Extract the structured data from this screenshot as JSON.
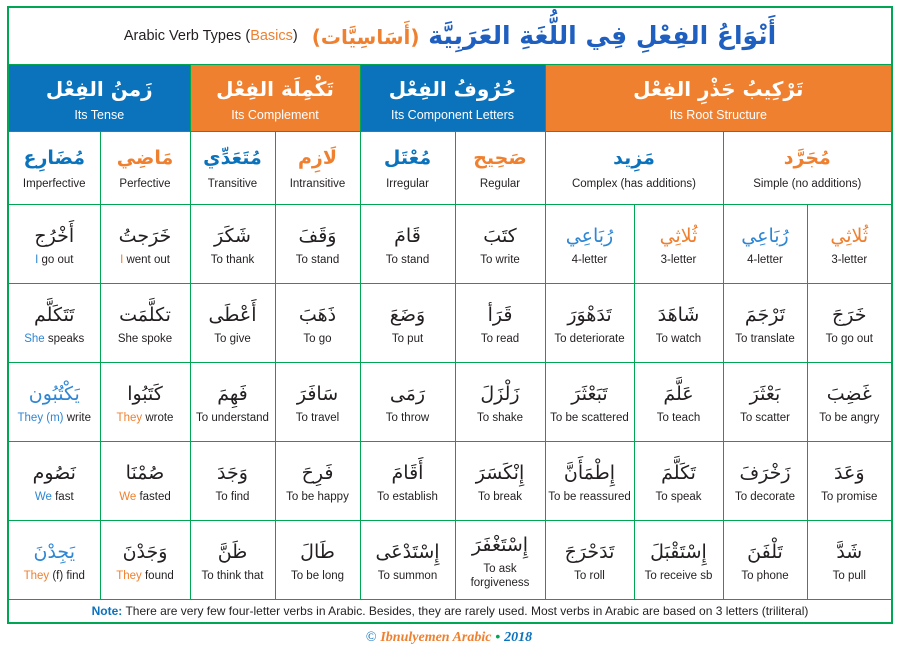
{
  "title": {
    "arabic_main": "أَنْوَاعُ الفِعْلِ فِي اللُّغَةِ العَرَبِيَّة",
    "arabic_paren": "(أَسَاسِيَّات)",
    "english_main": "Arabic Verb Types",
    "english_paren_open": "(",
    "english_basics": "Basics",
    "english_paren_close": ")"
  },
  "groups": [
    {
      "arabic": "زَمنُ الفِعْل",
      "english": "Its Tense",
      "color": "#0B72BC",
      "style": "blue",
      "span": 2
    },
    {
      "arabic": "تَكْمِلَة الفِعْل",
      "english": "Its Complement",
      "color": "#EF8030",
      "style": "orange",
      "span": 2
    },
    {
      "arabic": "حُرُوفُ الفِعْل",
      "english": "Its Component Letters",
      "color": "#0B72BC",
      "style": "blue",
      "span": 2
    },
    {
      "arabic": "تَرْكِيبُ جَذْرِ الفِعْل",
      "english": "Its Root Structure",
      "color": "#EF8030",
      "style": "orange",
      "span": 4
    }
  ],
  "subheaders": [
    {
      "arabic": "مُضَارِع",
      "english": "Imperfective",
      "color": "blue"
    },
    {
      "arabic": "مَاضِي",
      "english": "Perfective",
      "color": "orange"
    },
    {
      "arabic": "مُتَعَدِّي",
      "english": "Transitive",
      "color": "blue"
    },
    {
      "arabic": "لَازِم",
      "english": "Intransitive",
      "color": "orange"
    },
    {
      "arabic": "مُعْتَل",
      "english": "Irregular",
      "color": "blue"
    },
    {
      "arabic": "صَحِيح",
      "english": "Regular",
      "color": "orange"
    },
    {
      "arabic": "مَزِيد",
      "english": "Complex (has additions)",
      "color": "blue"
    },
    {
      "arabic": "مُجَرَّد",
      "english": "Simple (no additions)",
      "color": "orange"
    }
  ],
  "rows": [
    {
      "cells": [
        {
          "arabic": "أَخْرُج",
          "arabic_color": "plain",
          "english": "I go out",
          "english_highlight": "I",
          "highlight_color": "blue"
        },
        {
          "arabic": "خَرَجتُ",
          "arabic_color": "plain",
          "english": "I went out",
          "english_highlight": "I",
          "highlight_color": "orange"
        },
        {
          "arabic": "شَكَرَ",
          "arabic_color": "plain",
          "english": "To thank",
          "english_highlight": "",
          "highlight_color": ""
        },
        {
          "arabic": "وَقَفَ",
          "arabic_color": "plain",
          "english": "To stand",
          "english_highlight": "",
          "highlight_color": ""
        },
        {
          "arabic": "قَامَ",
          "arabic_color": "plain",
          "english": "To stand",
          "english_highlight": "",
          "highlight_color": ""
        },
        {
          "arabic": "كتَبَ",
          "arabic_color": "plain",
          "english": "To write",
          "english_highlight": "",
          "highlight_color": ""
        },
        {
          "arabic": "رُبَاعِي",
          "arabic_color": "blue",
          "english": "4-letter",
          "english_highlight": "",
          "highlight_color": ""
        },
        {
          "arabic": "ثُلاثِي",
          "arabic_color": "orange",
          "english": "3-letter",
          "english_highlight": "",
          "highlight_color": ""
        },
        {
          "arabic": "رُبَاعِي",
          "arabic_color": "blue",
          "english": "4-letter",
          "english_highlight": "",
          "highlight_color": ""
        },
        {
          "arabic": "ثُلاثِي",
          "arabic_color": "orange",
          "english": "3-letter",
          "english_highlight": "",
          "highlight_color": ""
        }
      ]
    },
    {
      "cells": [
        {
          "arabic": "تَتَكَلَّم",
          "arabic_color": "plain",
          "english": "She speaks",
          "english_highlight": "She",
          "highlight_color": "blue"
        },
        {
          "arabic": "تكلَّمَت",
          "arabic_color": "plain",
          "english": "She spoke",
          "english_highlight": "",
          "highlight_color": ""
        },
        {
          "arabic": "أَعْطَى",
          "arabic_color": "plain",
          "english": "To give",
          "english_highlight": "",
          "highlight_color": ""
        },
        {
          "arabic": "ذَهَبَ",
          "arabic_color": "plain",
          "english": "To go",
          "english_highlight": "",
          "highlight_color": ""
        },
        {
          "arabic": "وَضَعَ",
          "arabic_color": "plain",
          "english": "To put",
          "english_highlight": "",
          "highlight_color": ""
        },
        {
          "arabic": "قَرَأ",
          "arabic_color": "plain",
          "english": "To read",
          "english_highlight": "",
          "highlight_color": ""
        },
        {
          "arabic": "تَدَهْوَرَ",
          "arabic_color": "plain",
          "english": "To deteriorate",
          "english_highlight": "",
          "highlight_color": ""
        },
        {
          "arabic": "شَاهَدَ",
          "arabic_color": "plain",
          "english": "To watch",
          "english_highlight": "",
          "highlight_color": ""
        },
        {
          "arabic": "تَرْجَمَ",
          "arabic_color": "plain",
          "english": "To translate",
          "english_highlight": "",
          "highlight_color": ""
        },
        {
          "arabic": "خَرَجَ",
          "arabic_color": "plain",
          "english": "To go out",
          "english_highlight": "",
          "highlight_color": ""
        }
      ]
    },
    {
      "cells": [
        {
          "arabic": "يَكْتُبُون",
          "arabic_color": "blue",
          "english": "They (m) write",
          "english_highlight": "They (m)",
          "highlight_color": "blue"
        },
        {
          "arabic": "كَتَبُوا",
          "arabic_color": "plain",
          "english": "They wrote",
          "english_highlight": "They",
          "highlight_color": "orange"
        },
        {
          "arabic": "فَهِمَ",
          "arabic_color": "plain",
          "english": "To understand",
          "english_highlight": "",
          "highlight_color": ""
        },
        {
          "arabic": "سَافَرَ",
          "arabic_color": "plain",
          "english": "To travel",
          "english_highlight": "",
          "highlight_color": ""
        },
        {
          "arabic": "رَمَى",
          "arabic_color": "plain",
          "english": "To throw",
          "english_highlight": "",
          "highlight_color": ""
        },
        {
          "arabic": "زَلْزَلَ",
          "arabic_color": "plain",
          "english": "To shake",
          "english_highlight": "",
          "highlight_color": ""
        },
        {
          "arabic": "تَبَعْثَرَ",
          "arabic_color": "plain",
          "english": "To be scattered",
          "english_highlight": "",
          "highlight_color": ""
        },
        {
          "arabic": "عَلَّمَ",
          "arabic_color": "plain",
          "english": "To teach",
          "english_highlight": "",
          "highlight_color": ""
        },
        {
          "arabic": "بَعْثَرَ",
          "arabic_color": "plain",
          "english": "To scatter",
          "english_highlight": "",
          "highlight_color": ""
        },
        {
          "arabic": "غَضِبَ",
          "arabic_color": "plain",
          "english": "To be angry",
          "english_highlight": "",
          "highlight_color": ""
        }
      ]
    },
    {
      "cells": [
        {
          "arabic": "نَصُوم",
          "arabic_color": "plain",
          "english": "We fast",
          "english_highlight": "We",
          "highlight_color": "blue"
        },
        {
          "arabic": "صُمْنَا",
          "arabic_color": "plain",
          "english": "We fasted",
          "english_highlight": "We",
          "highlight_color": "orange"
        },
        {
          "arabic": "وَجَدَ",
          "arabic_color": "plain",
          "english": "To find",
          "english_highlight": "",
          "highlight_color": ""
        },
        {
          "arabic": "فَرِحَ",
          "arabic_color": "plain",
          "english": "To be happy",
          "english_highlight": "",
          "highlight_color": ""
        },
        {
          "arabic": "أَقَامَ",
          "arabic_color": "plain",
          "english": "To establish",
          "english_highlight": "",
          "highlight_color": ""
        },
        {
          "arabic": "إِنْكَسَرَ",
          "arabic_color": "plain",
          "english": "To break",
          "english_highlight": "",
          "highlight_color": ""
        },
        {
          "arabic": "إِطْمَأَنَّ",
          "arabic_color": "plain",
          "english": "To be reassured",
          "english_highlight": "",
          "highlight_color": ""
        },
        {
          "arabic": "تَكَلَّمَ",
          "arabic_color": "plain",
          "english": "To speak",
          "english_highlight": "",
          "highlight_color": ""
        },
        {
          "arabic": "زَخْرَفَ",
          "arabic_color": "plain",
          "english": "To decorate",
          "english_highlight": "",
          "highlight_color": ""
        },
        {
          "arabic": "وَعَدَ",
          "arabic_color": "plain",
          "english": "To promise",
          "english_highlight": "",
          "highlight_color": ""
        }
      ]
    },
    {
      "cells": [
        {
          "arabic": "يَجِدْنَ",
          "arabic_color": "blue",
          "english": "They (f) find",
          "english_highlight": "They",
          "highlight_color": "orange"
        },
        {
          "arabic": "وَجَدْنَ",
          "arabic_color": "plain",
          "english": "They found",
          "english_highlight": "They",
          "highlight_color": "orange"
        },
        {
          "arabic": "ظَنَّ",
          "arabic_color": "plain",
          "english": "To think that",
          "english_highlight": "",
          "highlight_color": ""
        },
        {
          "arabic": "طَالَ",
          "arabic_color": "plain",
          "english": "To be long",
          "english_highlight": "",
          "highlight_color": ""
        },
        {
          "arabic": "إِسْتَدْعَى",
          "arabic_color": "plain",
          "english": "To summon",
          "english_highlight": "",
          "highlight_color": ""
        },
        {
          "arabic": "إِسْتَغْفَرَ",
          "arabic_color": "plain",
          "english": "To ask forgiveness",
          "english_highlight": "",
          "highlight_color": ""
        },
        {
          "arabic": "تَدَحْرَجَ",
          "arabic_color": "plain",
          "english": "To roll",
          "english_highlight": "",
          "highlight_color": ""
        },
        {
          "arabic": "إِسْتَقْبَلَ",
          "arabic_color": "plain",
          "english": "To receive sb",
          "english_highlight": "",
          "highlight_color": ""
        },
        {
          "arabic": "تَلْفَنَ",
          "arabic_color": "plain",
          "english": "To phone",
          "english_highlight": "",
          "highlight_color": ""
        },
        {
          "arabic": "شَدَّ",
          "arabic_color": "plain",
          "english": "To pull",
          "english_highlight": "",
          "highlight_color": ""
        }
      ]
    }
  ],
  "note": {
    "label": "Note:",
    "text": "There are very few four-letter verbs in Arabic. Besides, they are rarely used. Most verbs in Arabic are based on 3 letters (triliteral)"
  },
  "credit": {
    "symbol": "©",
    "name": "Ibnulyemen Arabic",
    "separator": "•",
    "year": "2018"
  },
  "colors": {
    "blue": "#0B72BC",
    "orange": "#EF8030",
    "green_border": "#00A651",
    "title_blue": "#1F5FBF",
    "text_dark": "#231F20"
  }
}
